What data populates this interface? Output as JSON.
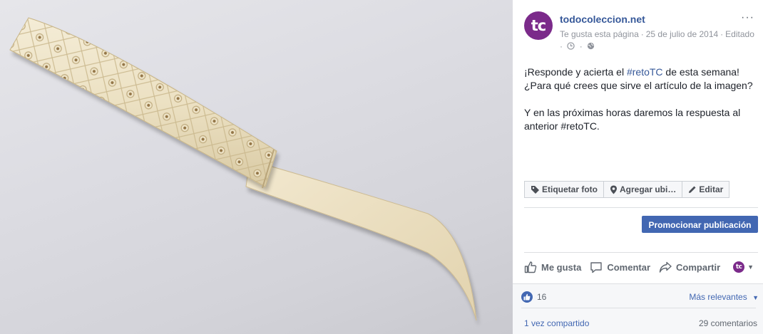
{
  "page": {
    "avatar_text": "tc",
    "name": "todocoleccion.net",
    "more_icon": "···",
    "meta": {
      "like_status": "Te gusta esta página",
      "date": "25 de julio de 2014",
      "edited": "Editado",
      "clock_icon": "clock-icon",
      "globe_icon": "globe-icon"
    }
  },
  "post": {
    "line1_a": "¡Responde y acierta el ",
    "line1_hashtag": "#retoTC",
    "line1_b": " de esta semana!",
    "line2": "¿Para qué crees que sirve el artículo de la imagen?",
    "line3": "Y en las próximas horas daremos la respuesta al anterior #retoTC."
  },
  "photo_actions": {
    "tag_photo": "Etiquetar foto",
    "add_location": "Agregar ubi…",
    "edit": "Editar"
  },
  "promote": {
    "label": "Promocionar publicación"
  },
  "actions": {
    "like": "Me gusta",
    "comment": "Comentar",
    "share": "Compartir",
    "avatar_text": "tc",
    "caret": "▼"
  },
  "footer": {
    "likes_count": "16",
    "most_relevant": "Más relevantes",
    "caret": "▼",
    "shared": "1 vez compartido",
    "comments": "29 comentarios"
  },
  "colors": {
    "brand_purple": "#7b2a8a",
    "link_blue": "#365899",
    "button_blue": "#4267b2"
  }
}
